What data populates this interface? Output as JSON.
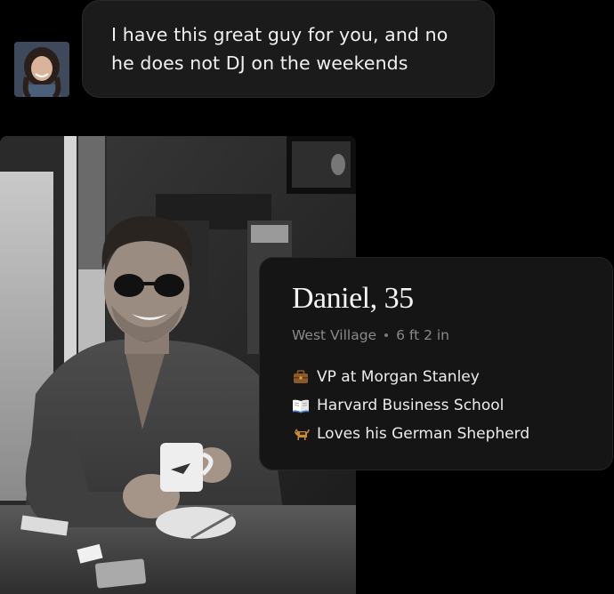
{
  "message": {
    "text": "I have this great guy for you, and no he does not DJ on the weekends"
  },
  "profile": {
    "name": "Daniel, 35",
    "location": "West Village",
    "height": "6 ft 2 in",
    "facts": [
      {
        "icon": "briefcase-icon",
        "label": "VP at Morgan Stanley"
      },
      {
        "icon": "open-book-icon",
        "label": "Harvard Business School"
      },
      {
        "icon": "dog-icon",
        "label": "Loves his German Shepherd"
      }
    ]
  },
  "colors": {
    "background": "#000000",
    "bubble": "#1b1b1b",
    "card": "#151515",
    "text_primary": "#f1f1f1",
    "text_muted": "#8a8a8a"
  }
}
